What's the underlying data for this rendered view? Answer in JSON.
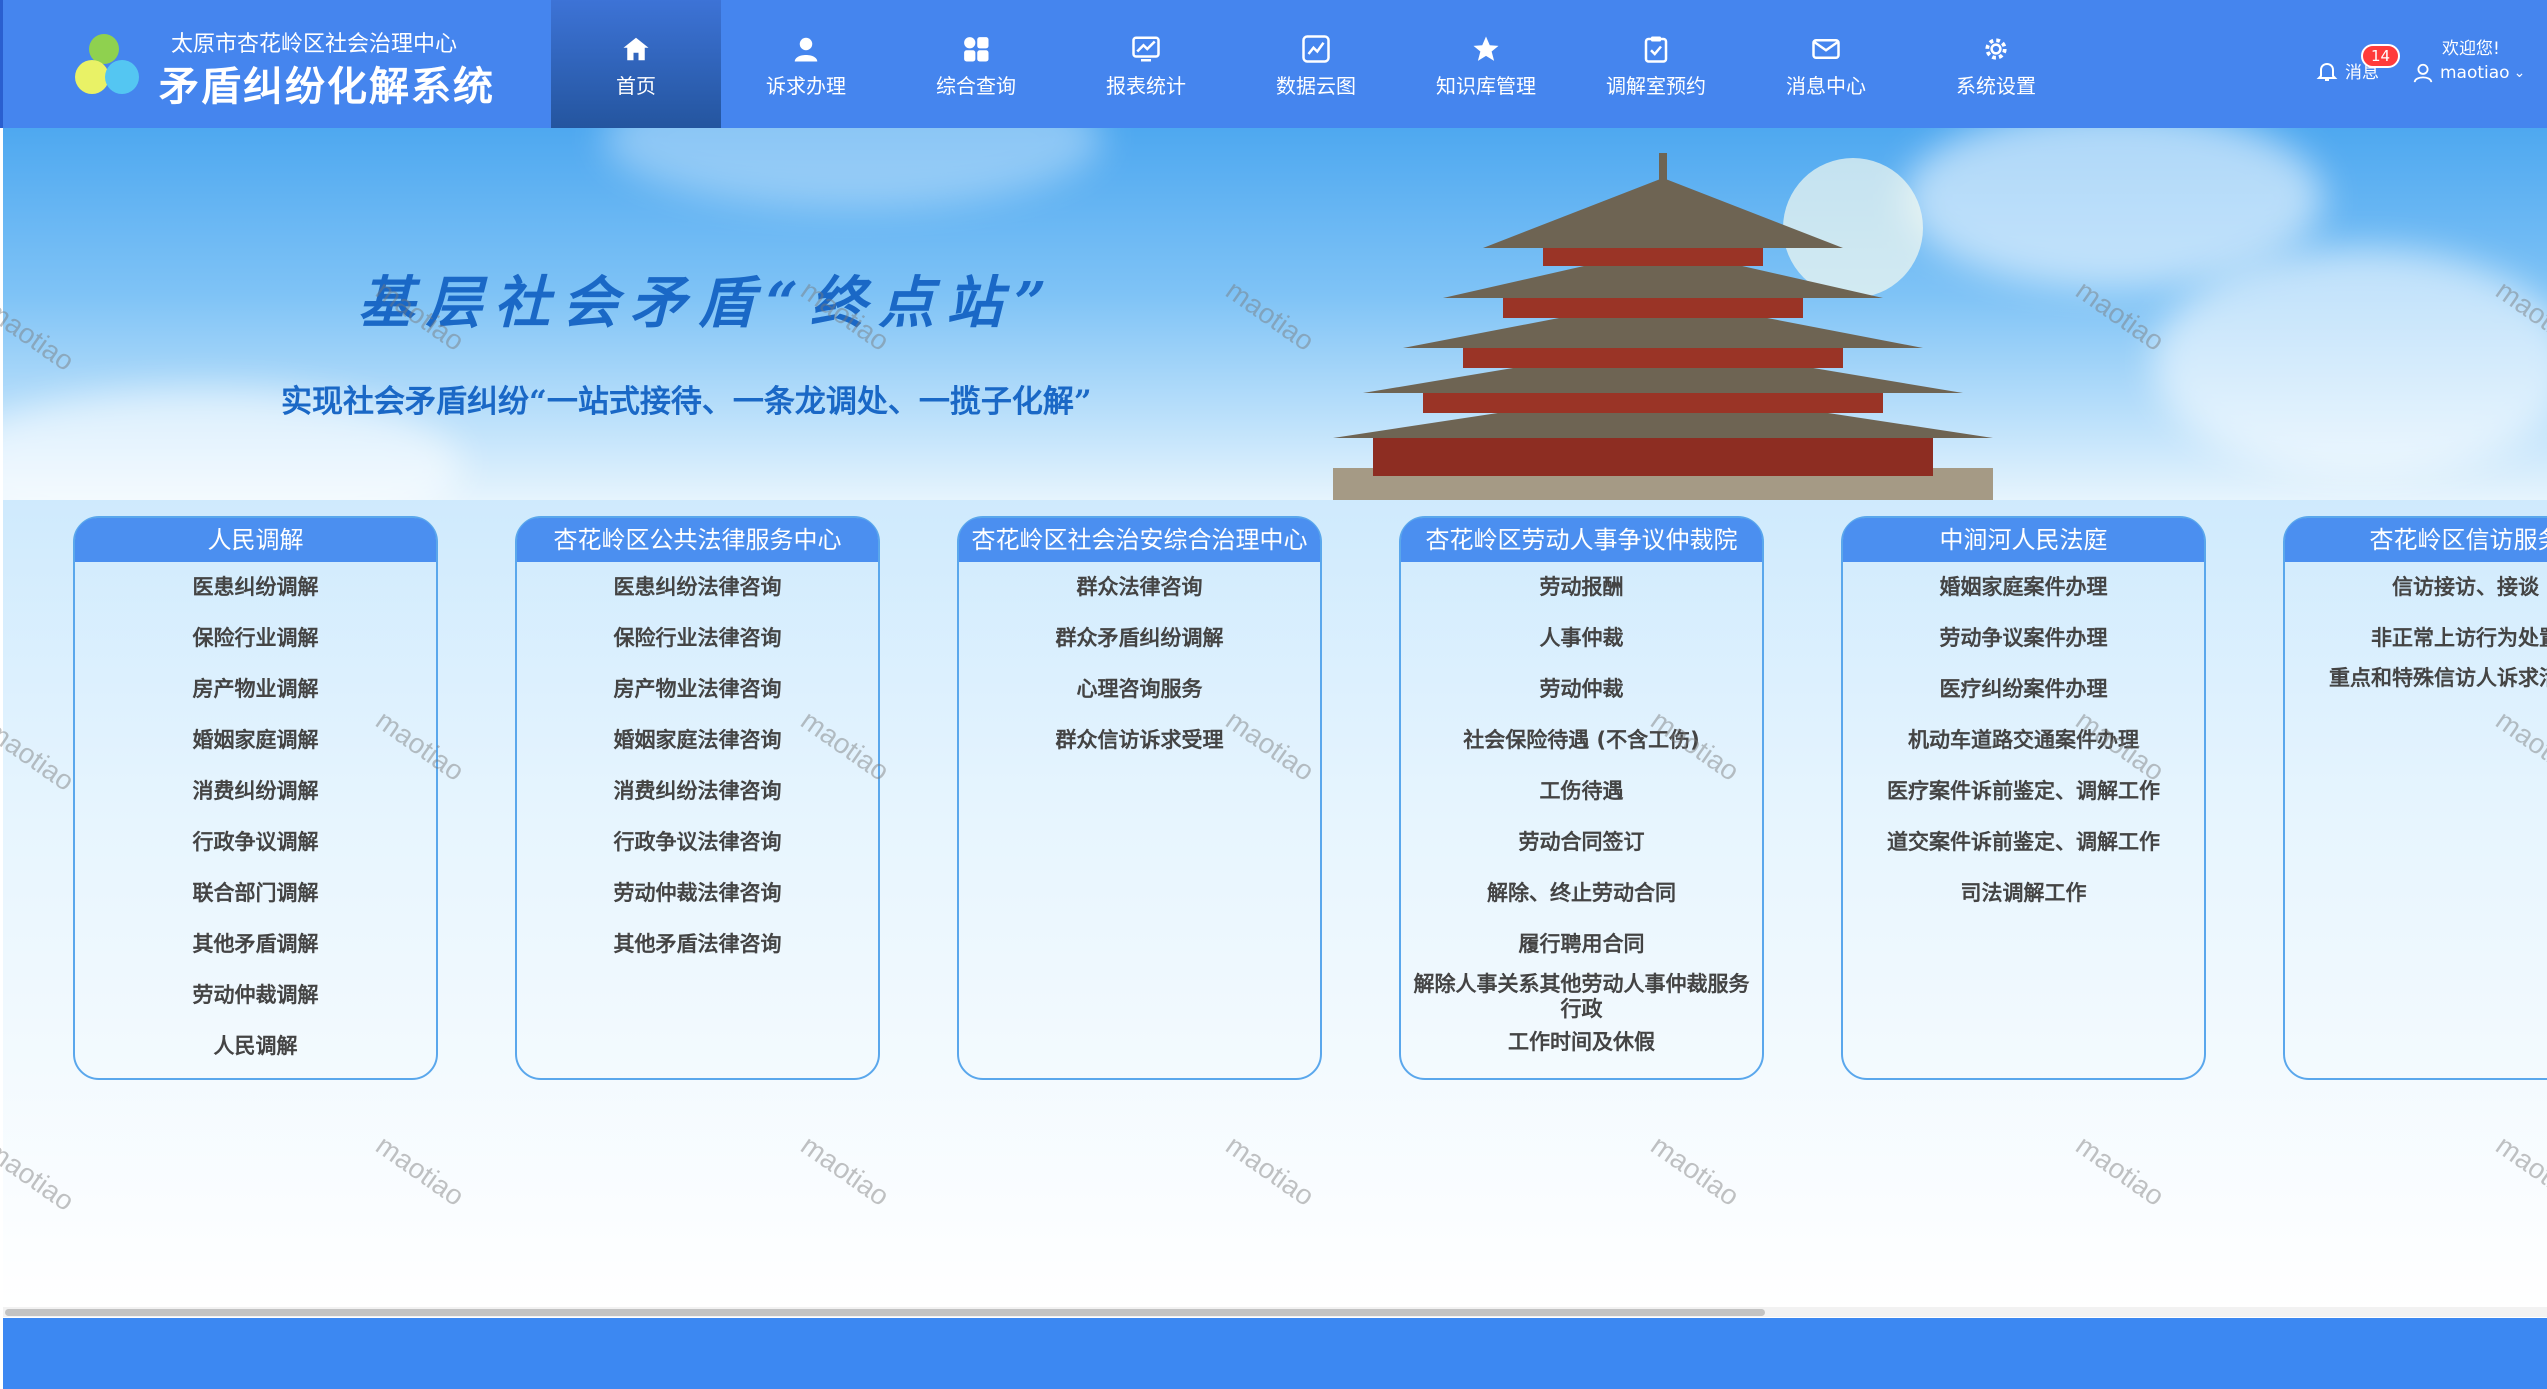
{
  "brand": {
    "subtitle": "太原市杏花岭区社会治理中心",
    "title": "矛盾纠纷化解系统"
  },
  "nav": [
    {
      "label": "首页",
      "icon": "home-icon",
      "active": true
    },
    {
      "label": "诉求办理",
      "icon": "user-icon"
    },
    {
      "label": "综合查询",
      "icon": "grid-icon"
    },
    {
      "label": "报表统计",
      "icon": "chart-icon"
    },
    {
      "label": "数据云图",
      "icon": "trend-icon"
    },
    {
      "label": "知识库管理",
      "icon": "star-icon"
    },
    {
      "label": "调解室预约",
      "icon": "clipboard-icon"
    },
    {
      "label": "消息中心",
      "icon": "mail-icon"
    },
    {
      "label": "系统设置",
      "icon": "gear-icon"
    }
  ],
  "header_right": {
    "message_label": "消息",
    "message_count": "14",
    "welcome": "欢迎您!",
    "username": "maotiao"
  },
  "banner": {
    "title": "基层社会矛盾“终点站”",
    "subtitle": "实现社会矛盾纠纷“一站式接待、一条龙调处、一揽子化解”"
  },
  "cards": [
    {
      "title": "人民调解",
      "items": [
        "医患纠纷调解",
        "保险行业调解",
        "房产物业调解",
        "婚姻家庭调解",
        "消费纠纷调解",
        "行政争议调解",
        "联合部门调解",
        "其他矛盾调解",
        "劳动仲裁调解",
        "人民调解"
      ]
    },
    {
      "title": "杏花岭区公共法律服务中心",
      "items": [
        "医患纠纷法律咨询",
        "保险行业法律咨询",
        "房产物业法律咨询",
        "婚姻家庭法律咨询",
        "消费纠纷法律咨询",
        "行政争议法律咨询",
        "劳动仲裁法律咨询",
        "其他矛盾法律咨询"
      ]
    },
    {
      "title": "杏花岭区社会治安综合治理中心",
      "items": [
        "群众法律咨询",
        "群众矛盾纠纷调解",
        "心理咨询服务",
        "群众信访诉求受理"
      ]
    },
    {
      "title": "杏花岭区劳动人事争议仲裁院",
      "items": [
        "劳动报酬",
        "人事仲裁",
        "劳动仲裁",
        "社会保险待遇 (不含工伤)",
        "工伤待遇",
        "劳动合同签订",
        "解除、终止劳动合同",
        "履行聘用合同",
        "解除人事关系其他劳动人事仲裁服务行政",
        "工作时间及休假"
      ]
    },
    {
      "title": "中涧河人民法庭",
      "items": [
        "婚姻家庭案件办理",
        "劳动争议案件办理",
        "医疗纠纷案件办理",
        "机动车道路交通案件办理",
        "医疗案件诉前鉴定、调解工作",
        "道交案件诉前鉴定、调解工作",
        "司法调解工作"
      ]
    },
    {
      "title": "杏花岭区信访服务",
      "items": [
        "信访接访、接谈",
        "非正常上访行为处置",
        "重点和特殊信访人诉求活动同"
      ]
    }
  ],
  "watermark": "maotiao"
}
